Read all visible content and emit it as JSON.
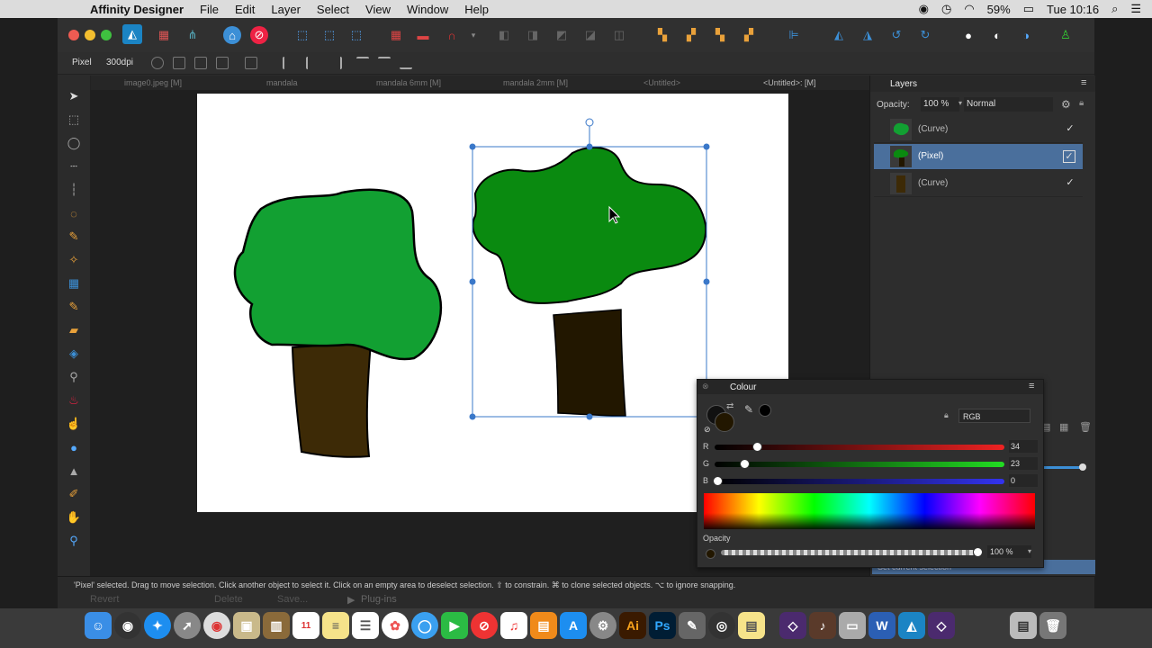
{
  "menubar": {
    "app_name": "Affinity Designer",
    "items": [
      "File",
      "Edit",
      "Layer",
      "Select",
      "View",
      "Window",
      "Help"
    ],
    "battery": "59%",
    "clock": "Tue 10:16"
  },
  "context_toolbar": {
    "mode": "Pixel",
    "dpi": "300dpi"
  },
  "tabs": [
    "image0.jpeg [M]",
    "mandala",
    "mandala 6mm [M]",
    "mandala 2mm [M]",
    "<Untitled>",
    "<Untitled>: [M]"
  ],
  "layers_panel": {
    "title": "Layers",
    "opacity_label": "Opacity:",
    "opacity_value": "100 %",
    "blend_mode": "Normal",
    "layers": [
      {
        "name": "(Curve)",
        "visible": true,
        "selected": false
      },
      {
        "name": "(Pixel)",
        "visible": true,
        "selected": true
      },
      {
        "name": "(Curve)",
        "visible": true,
        "selected": false
      }
    ],
    "history_hint": "Set current selection"
  },
  "colour_panel": {
    "title": "Colour",
    "model": "RGB",
    "r_label": "R",
    "r": "34",
    "g_label": "G",
    "g": "23",
    "b_label": "B",
    "b": "0",
    "opacity_label": "Opacity",
    "opacity_value": "100 %",
    "current_color": "#221700"
  },
  "status_bar": {
    "text": "'Pixel' selected. Drag to move selection. Click another object to select it. Click on an empty area to deselect selection. ⇧ to constrain. ⌘ to clone selected objects. ⌥ to ignore snapping."
  },
  "behind_panel": {
    "revert": "Revert",
    "delete": "Delete",
    "save": "Save...",
    "plugins": "Plug-ins"
  },
  "colors": {
    "tree_green": "#12a032",
    "tree_green_dark": "#0a8a10",
    "trunk_brown": "#3d2a06",
    "trunk_dark": "#221700",
    "selection_blue": "#3a78c9"
  }
}
